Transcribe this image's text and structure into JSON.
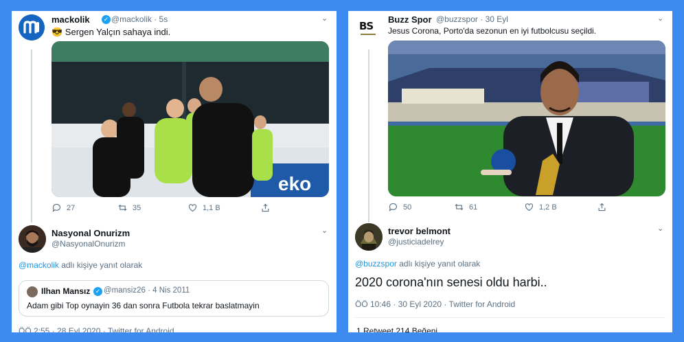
{
  "left": {
    "tweet": {
      "name": "mackolik",
      "handle": "@mackolik",
      "time": "5s",
      "text": "😎 Sergen Yalçın sahaya indi.",
      "replies": "27",
      "retweets": "35",
      "likes": "1,1 B"
    },
    "reply": {
      "name": "Nasyonal Onurizm",
      "handle": "@NasyonalOnurizm",
      "reply_to_handle": "@mackolik",
      "reply_to_suffix": "adlı kişiye yanıt olarak",
      "quote": {
        "name": "Ilhan Mansız",
        "handle": "@mansiz26",
        "date": "4 Nis 2011",
        "text": "Adam gibi Top oynayin 36 dan sonra Futbola tekrar baslatmayin"
      },
      "footer": "ÖÖ 2:55 · 28 Eyl 2020 · Twitter for Android"
    }
  },
  "right": {
    "tweet": {
      "name": "Buzz Spor",
      "handle": "@buzzspor",
      "time": "30 Eyl",
      "text": "Jesus Corona, Porto'da sezonun en iyi futbolcusu seçildi.",
      "replies": "50",
      "retweets": "61",
      "likes": "1,2 B",
      "logo_text": "BS"
    },
    "reply": {
      "name": "trevor belmont",
      "handle": "@justiciadelrey",
      "reply_to_handle": "@buzzspor",
      "reply_to_suffix": "adlı kişiye yanıt olarak",
      "text": "2020 corona'nın senesi oldu harbi..",
      "footer": "ÖÖ 10:46 · 30 Eyl 2020 · Twitter for Android",
      "stats": "1 Retweet   214 Beğeni"
    }
  },
  "colors": {
    "background": "#3d8af0",
    "link": "#1b95e0",
    "verified": "#1da1f2",
    "secondary_text": "#5b7083"
  },
  "icons": [
    "reply-icon",
    "retweet-icon",
    "like-icon",
    "share-icon",
    "verified-icon",
    "chevron-down-icon"
  ]
}
